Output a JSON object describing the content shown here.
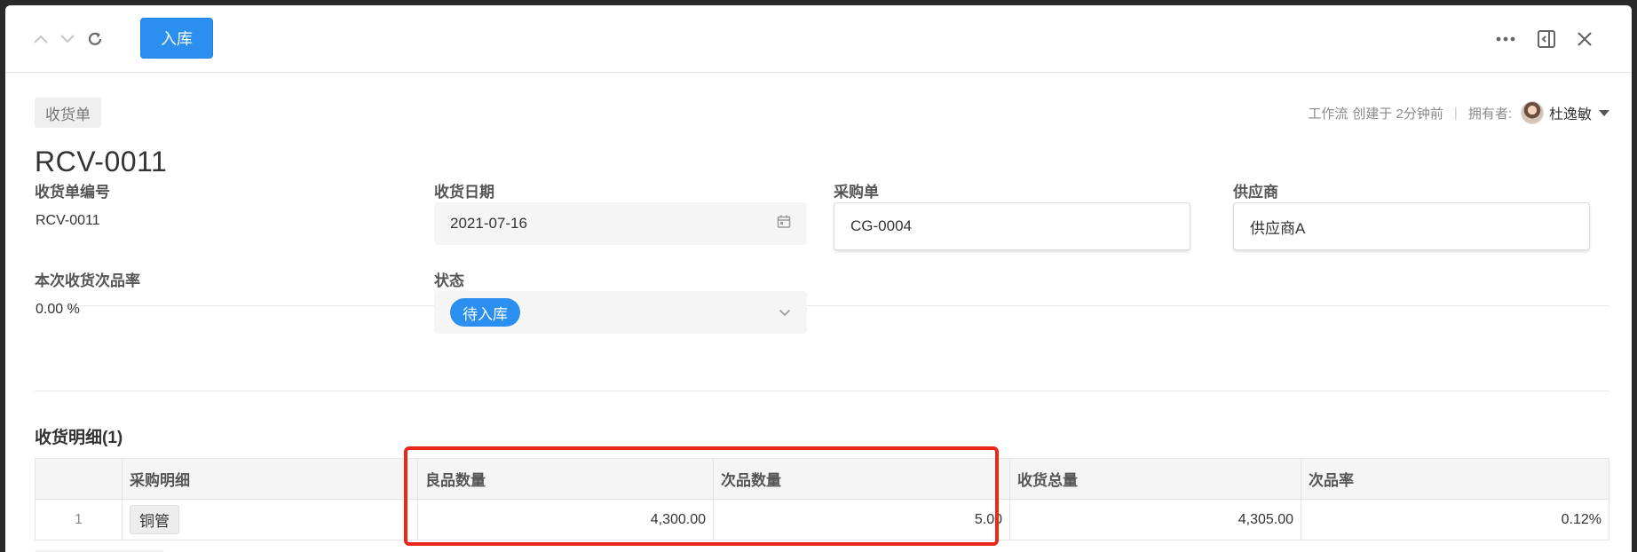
{
  "toolbar": {
    "primary_action": "入库"
  },
  "header": {
    "doc_type": "收货单",
    "meta_workflow": "工作流",
    "meta_created": "创建于 2分钟前",
    "owner_label": "拥有者:",
    "owner_name": "杜逸敏"
  },
  "record": {
    "title": "RCV-0011"
  },
  "fields": {
    "receipt_no": {
      "label": "收货单编号",
      "value": "RCV-0011"
    },
    "receipt_date": {
      "label": "收货日期",
      "value": "2021-07-16"
    },
    "purchase_order": {
      "label": "采购单",
      "value": "CG-0004"
    },
    "supplier": {
      "label": "供应商",
      "value": "供应商A"
    },
    "defect_rate": {
      "label": "本次收货次品率",
      "value": "0.00 %"
    },
    "status": {
      "label": "状态",
      "value": "待入库"
    }
  },
  "details": {
    "title": "收货明细(1)",
    "columns": [
      "",
      "采购明细",
      "良品数量",
      "次品数量",
      "收货总量",
      "次品率"
    ],
    "rows": [
      {
        "index": "1",
        "item": "铜管",
        "good_qty": "4,300.00",
        "defect_qty": "5.00",
        "total_qty": "4,305.00",
        "defect_rate": "0.12%"
      }
    ]
  },
  "colors": {
    "primary": "#2b8ff0",
    "highlight_border": "#e8281c"
  },
  "icons": [
    "chevron-up-icon",
    "chevron-down-icon",
    "refresh-icon",
    "more-icon",
    "panel-collapse-icon",
    "close-icon",
    "calendar-icon",
    "dropdown-chevron-icon"
  ]
}
